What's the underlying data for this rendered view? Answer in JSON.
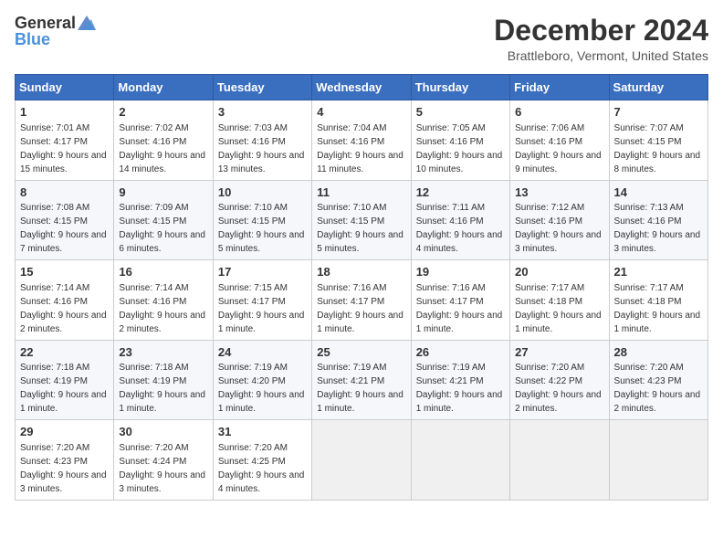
{
  "logo": {
    "general": "General",
    "blue": "Blue"
  },
  "title": "December 2024",
  "location": "Brattleboro, Vermont, United States",
  "days_of_week": [
    "Sunday",
    "Monday",
    "Tuesday",
    "Wednesday",
    "Thursday",
    "Friday",
    "Saturday"
  ],
  "weeks": [
    [
      {
        "day": "1",
        "sunrise": "7:01 AM",
        "sunset": "4:17 PM",
        "daylight": "9 hours and 15 minutes."
      },
      {
        "day": "2",
        "sunrise": "7:02 AM",
        "sunset": "4:16 PM",
        "daylight": "9 hours and 14 minutes."
      },
      {
        "day": "3",
        "sunrise": "7:03 AM",
        "sunset": "4:16 PM",
        "daylight": "9 hours and 13 minutes."
      },
      {
        "day": "4",
        "sunrise": "7:04 AM",
        "sunset": "4:16 PM",
        "daylight": "9 hours and 11 minutes."
      },
      {
        "day": "5",
        "sunrise": "7:05 AM",
        "sunset": "4:16 PM",
        "daylight": "9 hours and 10 minutes."
      },
      {
        "day": "6",
        "sunrise": "7:06 AM",
        "sunset": "4:16 PM",
        "daylight": "9 hours and 9 minutes."
      },
      {
        "day": "7",
        "sunrise": "7:07 AM",
        "sunset": "4:15 PM",
        "daylight": "9 hours and 8 minutes."
      }
    ],
    [
      {
        "day": "8",
        "sunrise": "7:08 AM",
        "sunset": "4:15 PM",
        "daylight": "9 hours and 7 minutes."
      },
      {
        "day": "9",
        "sunrise": "7:09 AM",
        "sunset": "4:15 PM",
        "daylight": "9 hours and 6 minutes."
      },
      {
        "day": "10",
        "sunrise": "7:10 AM",
        "sunset": "4:15 PM",
        "daylight": "9 hours and 5 minutes."
      },
      {
        "day": "11",
        "sunrise": "7:10 AM",
        "sunset": "4:15 PM",
        "daylight": "9 hours and 5 minutes."
      },
      {
        "day": "12",
        "sunrise": "7:11 AM",
        "sunset": "4:16 PM",
        "daylight": "9 hours and 4 minutes."
      },
      {
        "day": "13",
        "sunrise": "7:12 AM",
        "sunset": "4:16 PM",
        "daylight": "9 hours and 3 minutes."
      },
      {
        "day": "14",
        "sunrise": "7:13 AM",
        "sunset": "4:16 PM",
        "daylight": "9 hours and 3 minutes."
      }
    ],
    [
      {
        "day": "15",
        "sunrise": "7:14 AM",
        "sunset": "4:16 PM",
        "daylight": "9 hours and 2 minutes."
      },
      {
        "day": "16",
        "sunrise": "7:14 AM",
        "sunset": "4:16 PM",
        "daylight": "9 hours and 2 minutes."
      },
      {
        "day": "17",
        "sunrise": "7:15 AM",
        "sunset": "4:17 PM",
        "daylight": "9 hours and 1 minute."
      },
      {
        "day": "18",
        "sunrise": "7:16 AM",
        "sunset": "4:17 PM",
        "daylight": "9 hours and 1 minute."
      },
      {
        "day": "19",
        "sunrise": "7:16 AM",
        "sunset": "4:17 PM",
        "daylight": "9 hours and 1 minute."
      },
      {
        "day": "20",
        "sunrise": "7:17 AM",
        "sunset": "4:18 PM",
        "daylight": "9 hours and 1 minute."
      },
      {
        "day": "21",
        "sunrise": "7:17 AM",
        "sunset": "4:18 PM",
        "daylight": "9 hours and 1 minute."
      }
    ],
    [
      {
        "day": "22",
        "sunrise": "7:18 AM",
        "sunset": "4:19 PM",
        "daylight": "9 hours and 1 minute."
      },
      {
        "day": "23",
        "sunrise": "7:18 AM",
        "sunset": "4:19 PM",
        "daylight": "9 hours and 1 minute."
      },
      {
        "day": "24",
        "sunrise": "7:19 AM",
        "sunset": "4:20 PM",
        "daylight": "9 hours and 1 minute."
      },
      {
        "day": "25",
        "sunrise": "7:19 AM",
        "sunset": "4:21 PM",
        "daylight": "9 hours and 1 minute."
      },
      {
        "day": "26",
        "sunrise": "7:19 AM",
        "sunset": "4:21 PM",
        "daylight": "9 hours and 1 minute."
      },
      {
        "day": "27",
        "sunrise": "7:20 AM",
        "sunset": "4:22 PM",
        "daylight": "9 hours and 2 minutes."
      },
      {
        "day": "28",
        "sunrise": "7:20 AM",
        "sunset": "4:23 PM",
        "daylight": "9 hours and 2 minutes."
      }
    ],
    [
      {
        "day": "29",
        "sunrise": "7:20 AM",
        "sunset": "4:23 PM",
        "daylight": "9 hours and 3 minutes."
      },
      {
        "day": "30",
        "sunrise": "7:20 AM",
        "sunset": "4:24 PM",
        "daylight": "9 hours and 3 minutes."
      },
      {
        "day": "31",
        "sunrise": "7:20 AM",
        "sunset": "4:25 PM",
        "daylight": "9 hours and 4 minutes."
      },
      null,
      null,
      null,
      null
    ]
  ],
  "labels": {
    "sunrise": "Sunrise:",
    "sunset": "Sunset:",
    "daylight": "Daylight:"
  }
}
